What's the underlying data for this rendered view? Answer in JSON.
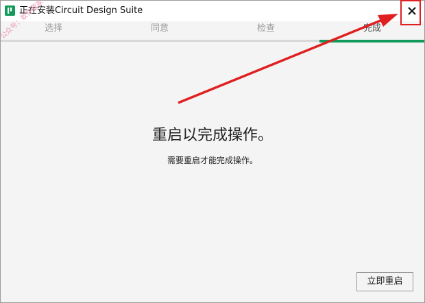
{
  "window": {
    "title": "正在安装Circuit Design Suite",
    "app_icon": "app-logo-icon",
    "close_icon": "close-icon"
  },
  "steps": [
    {
      "label": "选择"
    },
    {
      "label": "同意"
    },
    {
      "label": "检查"
    },
    {
      "label": "完成"
    }
  ],
  "main": {
    "title": "重启以完成操作。",
    "subtitle": "需要重启才能完成操作。"
  },
  "footer": {
    "restart_label": "立即重启"
  },
  "watermark": {
    "text": "公众号：软件管家"
  },
  "colors": {
    "accent": "#119a5a",
    "annotation": "#e02020"
  }
}
